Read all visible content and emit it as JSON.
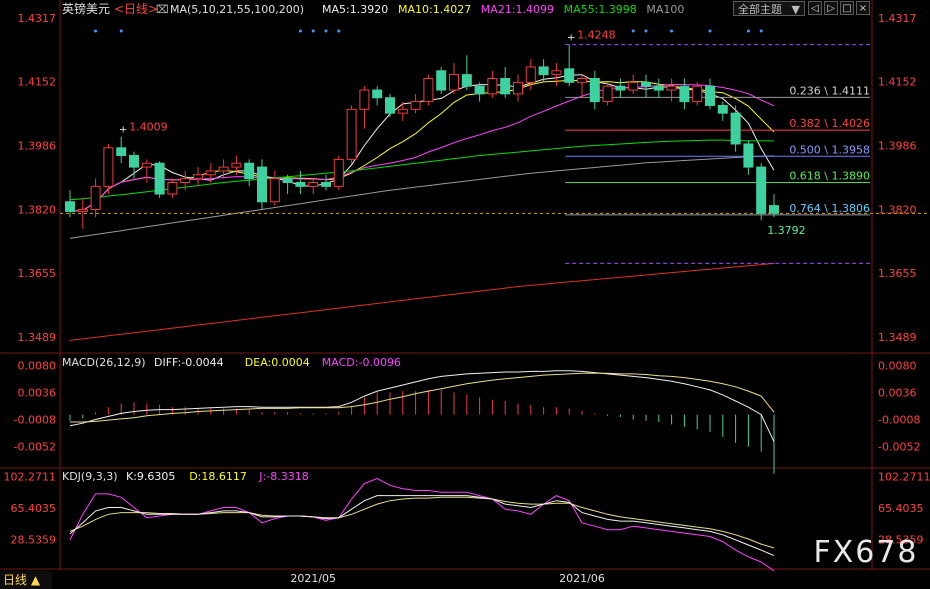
{
  "header": {
    "symbol": "英镑美元",
    "period": "日线",
    "ma_label": "MA(5,10,21,55,100,200)",
    "ma_values": [
      {
        "label": "MA5:1.3920",
        "color": "#f0f0f0"
      },
      {
        "label": "MA10:1.4027",
        "color": "#ffff00"
      },
      {
        "label": "MA21:1.4099",
        "color": "#ff40ff"
      },
      {
        "label": "MA55:1.3998",
        "color": "#00e000"
      },
      {
        "label": "MA100",
        "color": "#9a9a9a"
      }
    ],
    "theme_button": "全部主题",
    "window_buttons": [
      "◁",
      "▷",
      "□",
      "×"
    ]
  },
  "colors": {
    "up": "#ef3b3b",
    "down": "#3ed1a0",
    "axis_text": "#ff4040",
    "grid": "#3a3a3a"
  },
  "chart_data": [
    {
      "type": "candlestick",
      "panel": "price",
      "ylim": [
        1.345,
        1.4317
      ],
      "y_ticks": [
        "1.4317",
        "1.4152",
        "1.3986",
        "1.3820",
        "1.3655",
        "1.3489"
      ],
      "x_tick_labels": [
        {
          "label": "2021/05",
          "index": 19
        },
        {
          "label": "2021/06",
          "index": 40
        }
      ],
      "candles": [
        [
          1.384,
          1.387,
          1.38,
          1.3815
        ],
        [
          1.3815,
          1.385,
          1.377,
          1.382
        ],
        [
          1.382,
          1.39,
          1.38,
          1.388
        ],
        [
          1.388,
          1.399,
          1.386,
          1.398
        ],
        [
          1.398,
          1.4009,
          1.394,
          1.396
        ],
        [
          1.396,
          1.397,
          1.39,
          1.393
        ],
        [
          1.393,
          1.395,
          1.389,
          1.394
        ],
        [
          1.394,
          1.3945,
          1.385,
          1.386
        ],
        [
          1.386,
          1.39,
          1.385,
          1.389
        ],
        [
          1.389,
          1.392,
          1.387,
          1.39
        ],
        [
          1.39,
          1.393,
          1.388,
          1.391
        ],
        [
          1.391,
          1.394,
          1.389,
          1.392
        ],
        [
          1.392,
          1.395,
          1.39,
          1.393
        ],
        [
          1.393,
          1.396,
          1.391,
          1.394
        ],
        [
          1.394,
          1.395,
          1.388,
          1.39
        ],
        [
          1.393,
          1.395,
          1.382,
          1.384
        ],
        [
          1.384,
          1.392,
          1.383,
          1.39
        ],
        [
          1.39,
          1.391,
          1.386,
          1.389
        ],
        [
          1.389,
          1.392,
          1.386,
          1.388
        ],
        [
          1.388,
          1.39,
          1.386,
          1.389
        ],
        [
          1.389,
          1.391,
          1.387,
          1.388
        ],
        [
          1.388,
          1.396,
          1.387,
          1.395
        ],
        [
          1.395,
          1.409,
          1.394,
          1.408
        ],
        [
          1.408,
          1.414,
          1.403,
          1.413
        ],
        [
          1.413,
          1.414,
          1.409,
          1.411
        ],
        [
          1.411,
          1.412,
          1.406,
          1.407
        ],
        [
          1.407,
          1.41,
          1.405,
          1.408
        ],
        [
          1.408,
          1.412,
          1.407,
          1.41
        ],
        [
          1.41,
          1.417,
          1.409,
          1.416
        ],
        [
          1.418,
          1.419,
          1.412,
          1.413
        ],
        [
          1.413,
          1.42,
          1.412,
          1.417
        ],
        [
          1.417,
          1.422,
          1.413,
          1.414
        ],
        [
          1.414,
          1.415,
          1.41,
          1.412
        ],
        [
          1.412,
          1.418,
          1.411,
          1.416
        ],
        [
          1.416,
          1.419,
          1.411,
          1.412
        ],
        [
          1.412,
          1.417,
          1.41,
          1.415
        ],
        [
          1.415,
          1.421,
          1.413,
          1.419
        ],
        [
          1.419,
          1.421,
          1.415,
          1.417
        ],
        [
          1.417,
          1.42,
          1.414,
          1.418
        ],
        [
          1.4185,
          1.4248,
          1.414,
          1.415
        ],
        [
          1.415,
          1.417,
          1.411,
          1.416
        ],
        [
          1.416,
          1.418,
          1.408,
          1.41
        ],
        [
          1.41,
          1.415,
          1.409,
          1.414
        ],
        [
          1.414,
          1.416,
          1.411,
          1.413
        ],
        [
          1.413,
          1.417,
          1.412,
          1.415
        ],
        [
          1.415,
          1.417,
          1.411,
          1.414
        ],
        [
          1.414,
          1.416,
          1.411,
          1.413
        ],
        [
          1.413,
          1.416,
          1.41,
          1.414
        ],
        [
          1.414,
          1.416,
          1.408,
          1.41
        ],
        [
          1.41,
          1.415,
          1.409,
          1.414
        ],
        [
          1.414,
          1.416,
          1.408,
          1.409
        ],
        [
          1.409,
          1.41,
          1.405,
          1.407
        ],
        [
          1.407,
          1.409,
          1.397,
          1.399
        ],
        [
          1.399,
          1.4,
          1.391,
          1.393
        ],
        [
          1.393,
          1.394,
          1.3792,
          1.381
        ],
        [
          1.383,
          1.386,
          1.38,
          1.381
        ]
      ],
      "moving_averages": [
        {
          "name": "MA5",
          "color": "#f0f0f0",
          "period": 5
        },
        {
          "name": "MA10",
          "color": "#ffff00",
          "period": 10
        },
        {
          "name": "MA21",
          "color": "#ff40ff",
          "period": 21
        },
        {
          "name": "MA55",
          "color": "#00e000",
          "period": 55,
          "values": [
            1.3845,
            1.3848,
            1.3851,
            1.3855,
            1.3858,
            1.3862,
            1.3866,
            1.387,
            1.3874,
            1.3878,
            1.3882,
            1.3886,
            1.389,
            1.3893,
            1.3896,
            1.3899,
            1.3902,
            1.3905,
            1.3908,
            1.3911,
            1.3914,
            1.3917,
            1.392,
            1.3924,
            1.3928,
            1.3932,
            1.3936,
            1.394,
            1.3944,
            1.3948,
            1.3952,
            1.3956,
            1.396,
            1.3963,
            1.3966,
            1.3969,
            1.3972,
            1.3975,
            1.3978,
            1.3981,
            1.3984,
            1.3986,
            1.3988,
            1.399,
            1.3992,
            1.3994,
            1.3996,
            1.3997,
            1.3998,
            1.3999,
            1.4,
            1.4,
            1.3999,
            1.3998,
            1.3998,
            1.3998
          ]
        },
        {
          "name": "MA100",
          "color": "#9a9a9a",
          "period": 100,
          "values": [
            1.3745,
            1.375,
            1.3755,
            1.376,
            1.3765,
            1.377,
            1.3775,
            1.378,
            1.3785,
            1.379,
            1.3795,
            1.38,
            1.3805,
            1.381,
            1.3815,
            1.382,
            1.3825,
            1.383,
            1.3835,
            1.384,
            1.3845,
            1.385,
            1.3855,
            1.386,
            1.3865,
            1.387,
            1.3874,
            1.3878,
            1.3882,
            1.3886,
            1.389,
            1.3894,
            1.3898,
            1.3902,
            1.3906,
            1.391,
            1.3914,
            1.3917,
            1.392,
            1.3923,
            1.3926,
            1.3929,
            1.3932,
            1.3935,
            1.3938,
            1.3941,
            1.3943,
            1.3945,
            1.3947,
            1.3949,
            1.3951,
            1.3953,
            1.3955,
            1.3957,
            1.3958,
            1.3959
          ]
        },
        {
          "name": "MA200",
          "color": "#e03020",
          "period": 200,
          "values": [
            1.348,
            1.3484,
            1.3488,
            1.3492,
            1.3496,
            1.35,
            1.3504,
            1.3508,
            1.3512,
            1.3516,
            1.352,
            1.3524,
            1.3528,
            1.3532,
            1.3536,
            1.354,
            1.3544,
            1.3548,
            1.3552,
            1.3556,
            1.356,
            1.3564,
            1.3568,
            1.3572,
            1.3576,
            1.358,
            1.3584,
            1.3588,
            1.3592,
            1.3596,
            1.36,
            1.3604,
            1.3608,
            1.3612,
            1.3616,
            1.362,
            1.3623,
            1.3626,
            1.3629,
            1.3632,
            1.3635,
            1.3638,
            1.3641,
            1.3644,
            1.3647,
            1.365,
            1.3653,
            1.3656,
            1.3659,
            1.3662,
            1.3665,
            1.3668,
            1.3671,
            1.3674,
            1.3677,
            1.368
          ]
        }
      ],
      "fibonacci": {
        "start_index": 39,
        "levels": [
          {
            "label": "0.236 \\ 1.4111",
            "value": 1.4111,
            "color": "#9a9a9a",
            "text_color": "#d0d0d0"
          },
          {
            "label": "0.382 \\ 1.4026",
            "value": 1.4026,
            "color": "#ff4040",
            "text_color": "#ff4040"
          },
          {
            "label": "0.500 \\ 1.3958",
            "value": 1.3958,
            "color": "#6f7bff",
            "text_color": "#8f98ff"
          },
          {
            "label": "0.618 \\ 1.3890",
            "value": 1.389,
            "color": "#40e040",
            "text_color": "#50f050"
          },
          {
            "label": "0.764 \\ 1.3806",
            "value": 1.3806,
            "color": "#9a9a9a",
            "text_color": "#5ad2ff"
          }
        ],
        "dashed_levels": [
          1.4248,
          1.368
        ],
        "dashed_color": "#9b4dff"
      },
      "annotations": [
        {
          "label": "1.4009",
          "index": 4,
          "value": 1.4009,
          "position": "above",
          "color": "#ff4040"
        },
        {
          "label": "1.4248",
          "index": 39,
          "value": 1.4248,
          "position": "above",
          "color": "#ff4040"
        },
        {
          "label": "1.3792",
          "index": 54,
          "value": 1.3792,
          "position": "below",
          "color": "#50f0a0"
        }
      ],
      "current_price": 1.381,
      "signal_dot_indices": [
        2,
        4,
        18,
        19,
        20,
        21,
        44,
        45,
        47,
        50,
        53,
        54
      ]
    },
    {
      "type": "macd",
      "panel": "macd",
      "title": "MACD(26,12,9)",
      "legend": [
        {
          "label": "DIFF:-0.0044",
          "color": "#f0f0f0"
        },
        {
          "label": "DEA:0.0004",
          "color": "#ffff00"
        },
        {
          "label": "MACD:-0.0096",
          "color": "#ff40ff"
        }
      ],
      "ylim": [
        -0.0085,
        0.0095
      ],
      "y_ticks": [
        "0.0080",
        "0.0036",
        "-0.0008",
        "-0.0052"
      ],
      "diff": [
        -0.0018,
        -0.0014,
        -0.0008,
        -0.0003,
        0.0002,
        0.0005,
        0.0007,
        0.0008,
        0.0008,
        0.0009,
        0.001,
        0.0011,
        0.0012,
        0.0013,
        0.0013,
        0.0012,
        0.0012,
        0.0012,
        0.0012,
        0.0012,
        0.0012,
        0.0013,
        0.002,
        0.003,
        0.0038,
        0.0043,
        0.0048,
        0.0053,
        0.0058,
        0.0062,
        0.0064,
        0.0066,
        0.0067,
        0.0068,
        0.0069,
        0.0069,
        0.007,
        0.007,
        0.0071,
        0.0071,
        0.007,
        0.0068,
        0.0066,
        0.0064,
        0.0062,
        0.006,
        0.0057,
        0.0054,
        0.005,
        0.0045,
        0.004,
        0.0032,
        0.0022,
        0.0012,
        0.0,
        -0.0044
      ],
      "dea": [
        -0.0012,
        -0.0012,
        -0.0011,
        -0.0009,
        -0.0007,
        -0.0005,
        -0.0002,
        0.0,
        0.0002,
        0.0003,
        0.0005,
        0.0006,
        0.0007,
        0.0008,
        0.0009,
        0.001,
        0.001,
        0.001,
        0.0011,
        0.0011,
        0.0011,
        0.0011,
        0.0013,
        0.0016,
        0.002,
        0.0025,
        0.0029,
        0.0034,
        0.0038,
        0.0042,
        0.0046,
        0.005,
        0.0053,
        0.0056,
        0.0058,
        0.006,
        0.0062,
        0.0064,
        0.0065,
        0.0066,
        0.0067,
        0.0067,
        0.0067,
        0.0066,
        0.0066,
        0.0065,
        0.0063,
        0.0062,
        0.006,
        0.0057,
        0.0054,
        0.005,
        0.0045,
        0.0038,
        0.003,
        0.0004
      ],
      "histogram": [
        -0.001,
        -0.0006,
        0.0004,
        0.0012,
        0.0018,
        0.002,
        0.0018,
        0.0016,
        0.0012,
        0.0012,
        0.001,
        0.001,
        0.001,
        0.001,
        0.0008,
        0.0004,
        0.0004,
        0.0004,
        0.0002,
        0.0002,
        0.0002,
        0.0004,
        0.0014,
        0.0028,
        0.0036,
        0.0036,
        0.0038,
        0.0038,
        0.004,
        0.004,
        0.0036,
        0.0032,
        0.0028,
        0.0024,
        0.0022,
        0.0018,
        0.0016,
        0.0012,
        0.0012,
        0.001,
        0.0006,
        0.0002,
        -0.0002,
        -0.0004,
        -0.0008,
        -0.001,
        -0.0012,
        -0.0016,
        -0.002,
        -0.0024,
        -0.0028,
        -0.0036,
        -0.0046,
        -0.0052,
        -0.006,
        -0.0096
      ]
    },
    {
      "type": "kdj",
      "panel": "kdj",
      "title": "KDJ(9,3,3)",
      "legend": [
        {
          "label": "K:9.6305",
          "color": "#f0f0f0"
        },
        {
          "label": "D:18.6117",
          "color": "#ffff00"
        },
        {
          "label": "J:-8.3318",
          "color": "#ff40ff"
        }
      ],
      "ylim": [
        -5,
        110
      ],
      "y_ticks": [
        "102.2711",
        "65.4035",
        "28.5359"
      ],
      "k": [
        35,
        48,
        62,
        66,
        66,
        62,
        58,
        58,
        58,
        58,
        58,
        60,
        62,
        62,
        60,
        55,
        55,
        56,
        56,
        55,
        53,
        54,
        64,
        74,
        80,
        80,
        80,
        80,
        80,
        80,
        80,
        80,
        78,
        76,
        70,
        68,
        66,
        70,
        74,
        72,
        60,
        56,
        52,
        50,
        50,
        48,
        46,
        44,
        42,
        40,
        38,
        34,
        28,
        22,
        16,
        9.6
      ],
      "d": [
        38,
        44,
        52,
        58,
        60,
        60,
        60,
        59,
        59,
        58,
        58,
        59,
        60,
        60,
        60,
        57,
        56,
        56,
        56,
        55,
        54,
        54,
        58,
        64,
        70,
        74,
        76,
        77,
        77,
        78,
        78,
        78,
        77,
        76,
        73,
        71,
        70,
        70,
        71,
        71,
        66,
        62,
        58,
        55,
        53,
        51,
        49,
        47,
        45,
        43,
        41,
        38,
        34,
        29,
        23,
        18.6
      ],
      "j": [
        28,
        58,
        82,
        82,
        78,
        66,
        54,
        56,
        58,
        58,
        58,
        62,
        66,
        66,
        60,
        48,
        53,
        56,
        56,
        55,
        51,
        54,
        76,
        94,
        100,
        92,
        88,
        86,
        86,
        84,
        84,
        84,
        80,
        76,
        64,
        62,
        58,
        70,
        80,
        74,
        48,
        44,
        40,
        40,
        44,
        42,
        40,
        38,
        36,
        34,
        32,
        26,
        16,
        8,
        2,
        -8.3
      ]
    }
  ],
  "footer": {
    "period_button": "日线",
    "watermark": "FX678"
  }
}
